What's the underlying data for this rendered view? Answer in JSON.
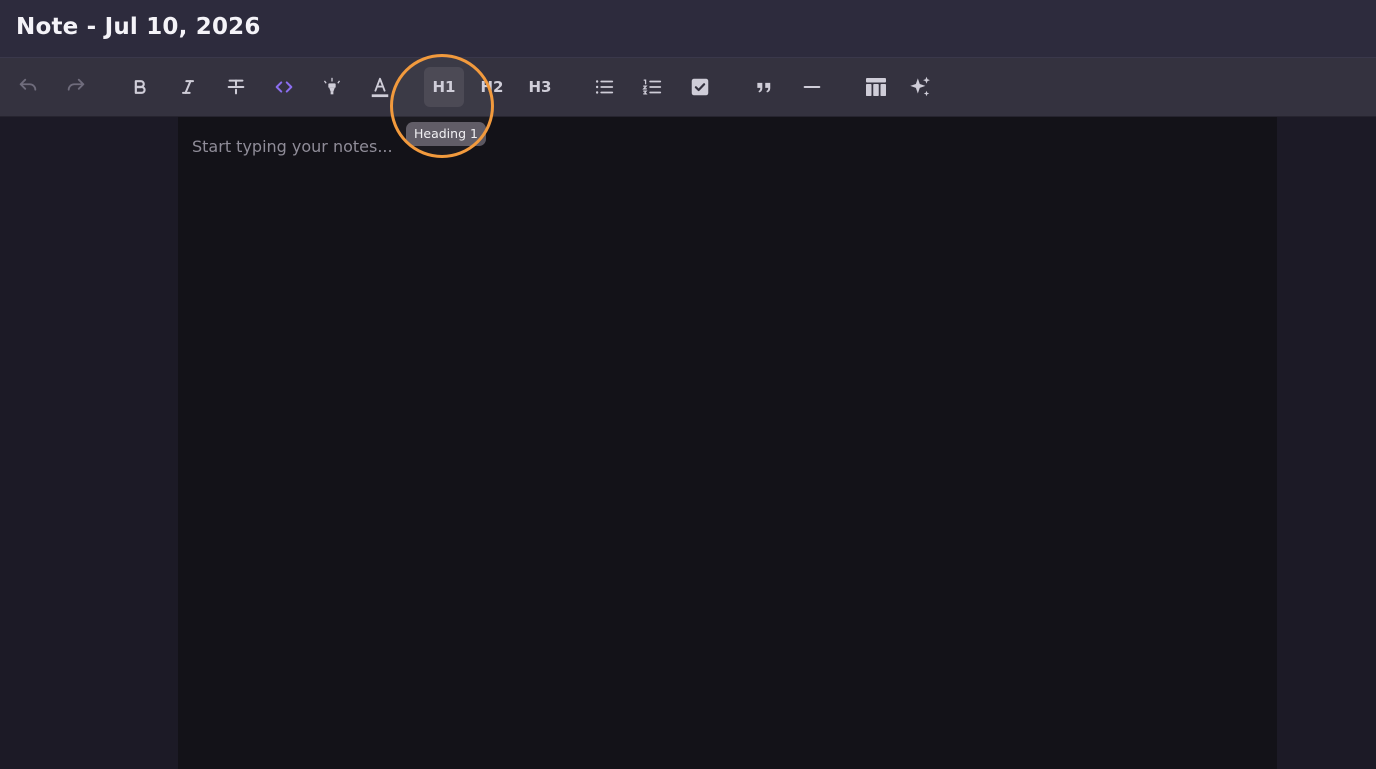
{
  "header": {
    "title": "Note - Jul 10, 2026"
  },
  "toolbar": {
    "heading1_label": "H1",
    "heading2_label": "H2",
    "heading3_label": "H3",
    "tooltip": "Heading 1"
  },
  "editor": {
    "placeholder": "Start typing your notes..."
  },
  "colors": {
    "accent": "#8b6ef0",
    "highlight_ring": "#f29a3d"
  }
}
